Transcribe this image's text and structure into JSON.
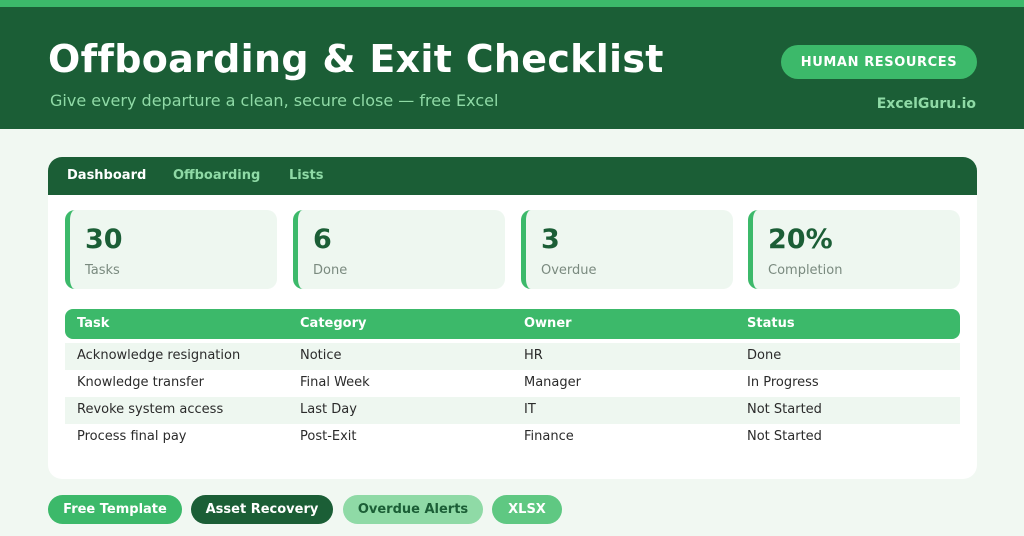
{
  "header": {
    "title": "Offboarding & Exit Checklist",
    "subtitle": "Give every departure a clean, secure close — free Excel",
    "badge": "HUMAN RESOURCES",
    "brand": "ExcelGuru.io"
  },
  "tabs": [
    {
      "label": "Dashboard",
      "active": true
    },
    {
      "label": "Offboarding",
      "active": false
    },
    {
      "label": "Lists",
      "active": false
    }
  ],
  "kpis": [
    {
      "value": "30",
      "label": "Tasks"
    },
    {
      "value": "6",
      "label": "Done"
    },
    {
      "value": "3",
      "label": "Overdue"
    },
    {
      "value": "20%",
      "label": "Completion"
    }
  ],
  "table": {
    "columns": [
      "Task",
      "Category",
      "Owner",
      "Status"
    ],
    "rows": [
      [
        "Acknowledge resignation",
        "Notice",
        "HR",
        "Done"
      ],
      [
        "Knowledge transfer",
        "Final Week",
        "Manager",
        "In Progress"
      ],
      [
        "Revoke system access",
        "Last Day",
        "IT",
        "Not Started"
      ],
      [
        "Process final pay",
        "Post-Exit",
        "Finance",
        "Not Started"
      ]
    ]
  },
  "tags": [
    {
      "label": "Free Template",
      "bg": "#3cb96a",
      "fg": "#ffffff"
    },
    {
      "label": "Asset Recovery",
      "bg": "#1b5e36",
      "fg": "#ffffff"
    },
    {
      "label": "Overdue Alerts",
      "bg": "#8fdaa6",
      "fg": "#1b5e36"
    },
    {
      "label": "XLSX",
      "bg": "#5fc882",
      "fg": "#ffffff"
    }
  ],
  "colors": {
    "primary_dark": "#1b5e36",
    "accent": "#3cb96a",
    "accent_light": "#8fdaa6",
    "background": "#f1f8f2"
  }
}
